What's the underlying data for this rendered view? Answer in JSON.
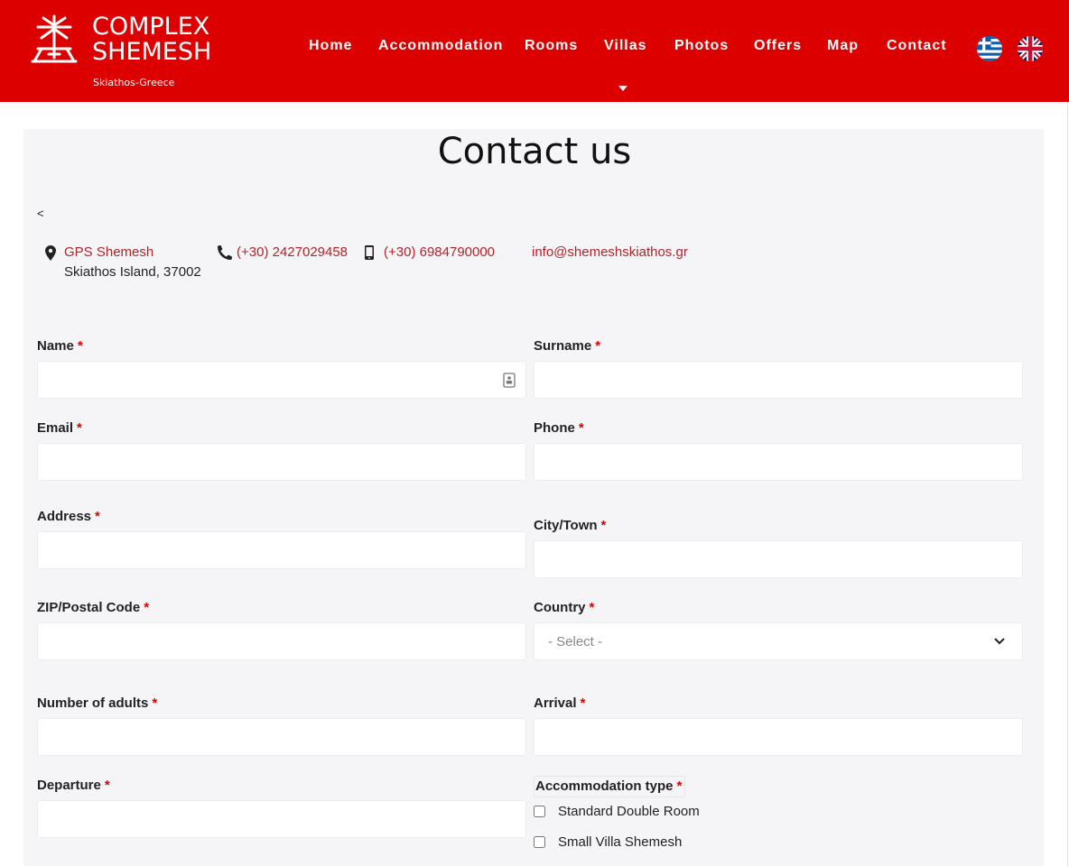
{
  "brand": {
    "line1": "COMPLEX",
    "line2": "SHEMESH",
    "tagline": "Skiathos-Greece",
    "accent": "#dd0000"
  },
  "nav": {
    "items": [
      {
        "label": "Home"
      },
      {
        "label": "Accommodation"
      },
      {
        "label": "Rooms"
      },
      {
        "label": "Villas"
      },
      {
        "label": "Photos"
      },
      {
        "label": "Offers"
      },
      {
        "label": "Map"
      },
      {
        "label": "Contact"
      }
    ],
    "languages": [
      "greek-flag-icon",
      "uk-flag-icon"
    ]
  },
  "page": {
    "title": "Contact us",
    "back": "<"
  },
  "contact_info": {
    "gps_label": "GPS Shemesh",
    "address": "Skiathos Island, 37002",
    "phone": "(+30) 2427029458",
    "mobile": "(+30) 6984790000",
    "email": "info@shemeshskiathos.gr",
    "link_color": "#b0242b"
  },
  "form": {
    "required_mark": "*",
    "name": {
      "label": "Name",
      "value": ""
    },
    "surname": {
      "label": "Surname",
      "value": ""
    },
    "email": {
      "label": "Email",
      "value": ""
    },
    "phone": {
      "label": "Phone",
      "value": ""
    },
    "address": {
      "label": "Address",
      "value": ""
    },
    "city": {
      "label": "City/Town",
      "value": ""
    },
    "zip": {
      "label": "ZIP/Postal Code",
      "value": ""
    },
    "country": {
      "label": "Country",
      "selected": "- Select -"
    },
    "adults": {
      "label": "Number of adults",
      "value": ""
    },
    "arrival": {
      "label": "Arrival",
      "value": ""
    },
    "departure": {
      "label": "Departure",
      "value": ""
    },
    "accommodation": {
      "label": "Accommodation type",
      "options": [
        {
          "label": "Standard Double Room",
          "checked": false
        },
        {
          "label": "Small Villa Shemesh",
          "checked": false
        }
      ]
    }
  }
}
